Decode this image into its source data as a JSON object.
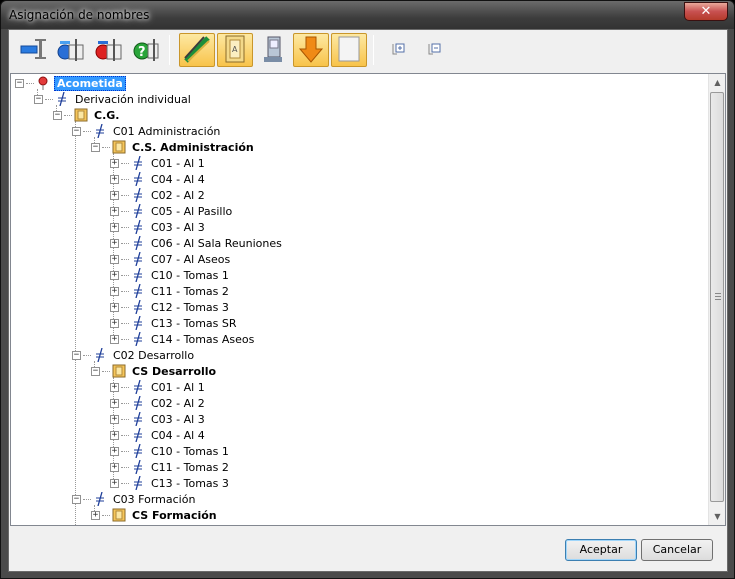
{
  "window": {
    "title": "Asignación de nombres",
    "close_label": "✕"
  },
  "toolbar": {
    "buttons": [
      {
        "name": "toolbar-button-1",
        "icon": "rename-field-icon"
      },
      {
        "name": "toolbar-button-2",
        "icon": "rename-blue-icon"
      },
      {
        "name": "toolbar-button-3",
        "icon": "rename-red-icon"
      },
      {
        "name": "toolbar-button-4",
        "icon": "rename-green-help-icon"
      },
      {
        "name": "toolbar-button-5",
        "icon": "cable-icon",
        "active": true
      },
      {
        "name": "toolbar-button-6",
        "icon": "panel-icon",
        "active": true
      },
      {
        "name": "toolbar-button-7",
        "icon": "switch-icon"
      },
      {
        "name": "toolbar-button-8",
        "icon": "arrow-down-icon",
        "active": true
      },
      {
        "name": "toolbar-button-9",
        "icon": "blank-panel-icon",
        "active": true
      },
      {
        "name": "expand-all",
        "icon": "expand-tree-icon"
      },
      {
        "name": "collapse-all",
        "icon": "collapse-tree-icon"
      }
    ]
  },
  "tree": {
    "nodes": [
      {
        "level": 0,
        "label": "Acometida",
        "icon": "pin-icon",
        "expander": "−",
        "bold": true,
        "selected": true
      },
      {
        "level": 1,
        "label": "Derivación individual",
        "icon": "line-icon",
        "expander": "−"
      },
      {
        "level": 2,
        "label": "C.G.",
        "icon": "panel-icon",
        "expander": "−",
        "bold": true
      },
      {
        "level": 3,
        "label": "C01 Administración",
        "icon": "line-icon",
        "expander": "−"
      },
      {
        "level": 4,
        "label": "C.S. Administración",
        "icon": "panel-icon",
        "expander": "−",
        "bold": true
      },
      {
        "level": 5,
        "label": "C01 - Al 1",
        "icon": "line-icon",
        "expander": "+"
      },
      {
        "level": 5,
        "label": "C04 - Al 4",
        "icon": "line-icon",
        "expander": "+"
      },
      {
        "level": 5,
        "label": "C02 - Al 2",
        "icon": "line-icon",
        "expander": "+"
      },
      {
        "level": 5,
        "label": "C05 - Al Pasillo",
        "icon": "line-icon",
        "expander": "+"
      },
      {
        "level": 5,
        "label": "C03 - Al 3",
        "icon": "line-icon",
        "expander": "+"
      },
      {
        "level": 5,
        "label": "C06 - Al Sala Reuniones",
        "icon": "line-icon",
        "expander": "+"
      },
      {
        "level": 5,
        "label": "C07 - Al Aseos",
        "icon": "line-icon",
        "expander": "+"
      },
      {
        "level": 5,
        "label": "C10 - Tomas 1",
        "icon": "line-icon",
        "expander": "+"
      },
      {
        "level": 5,
        "label": "C11 - Tomas 2",
        "icon": "line-icon",
        "expander": "+"
      },
      {
        "level": 5,
        "label": "C12 - Tomas 3",
        "icon": "line-icon",
        "expander": "+"
      },
      {
        "level": 5,
        "label": "C13 - Tomas SR",
        "icon": "line-icon",
        "expander": "+"
      },
      {
        "level": 5,
        "label": "C14 - Tomas Aseos",
        "icon": "line-icon",
        "expander": "+"
      },
      {
        "level": 3,
        "label": "C02 Desarrollo",
        "icon": "line-icon",
        "expander": "−"
      },
      {
        "level": 4,
        "label": "CS Desarrollo",
        "icon": "panel-icon",
        "expander": "−",
        "bold": true
      },
      {
        "level": 5,
        "label": "C01 - Al 1",
        "icon": "line-icon",
        "expander": "+"
      },
      {
        "level": 5,
        "label": "C02 - Al 2",
        "icon": "line-icon",
        "expander": "+"
      },
      {
        "level": 5,
        "label": "C03 - Al 3",
        "icon": "line-icon",
        "expander": "+"
      },
      {
        "level": 5,
        "label": "C04 - Al 4",
        "icon": "line-icon",
        "expander": "+"
      },
      {
        "level": 5,
        "label": "C10 - Tomas 1",
        "icon": "line-icon",
        "expander": "+"
      },
      {
        "level": 5,
        "label": "C11 - Tomas 2",
        "icon": "line-icon",
        "expander": "+"
      },
      {
        "level": 5,
        "label": "C13 - Tomas 3",
        "icon": "line-icon",
        "expander": "+"
      },
      {
        "level": 3,
        "label": "C03 Formación",
        "icon": "line-icon",
        "expander": "−"
      },
      {
        "level": 4,
        "label": "CS Formación",
        "icon": "panel-icon",
        "expander": "+",
        "bold": true
      }
    ]
  },
  "buttons": {
    "accept": "Aceptar",
    "cancel": "Cancelar"
  },
  "colors": {
    "selection": "#3399ff",
    "panel_icon": "#f7c65a",
    "line_icon": "#1f3f9a"
  }
}
